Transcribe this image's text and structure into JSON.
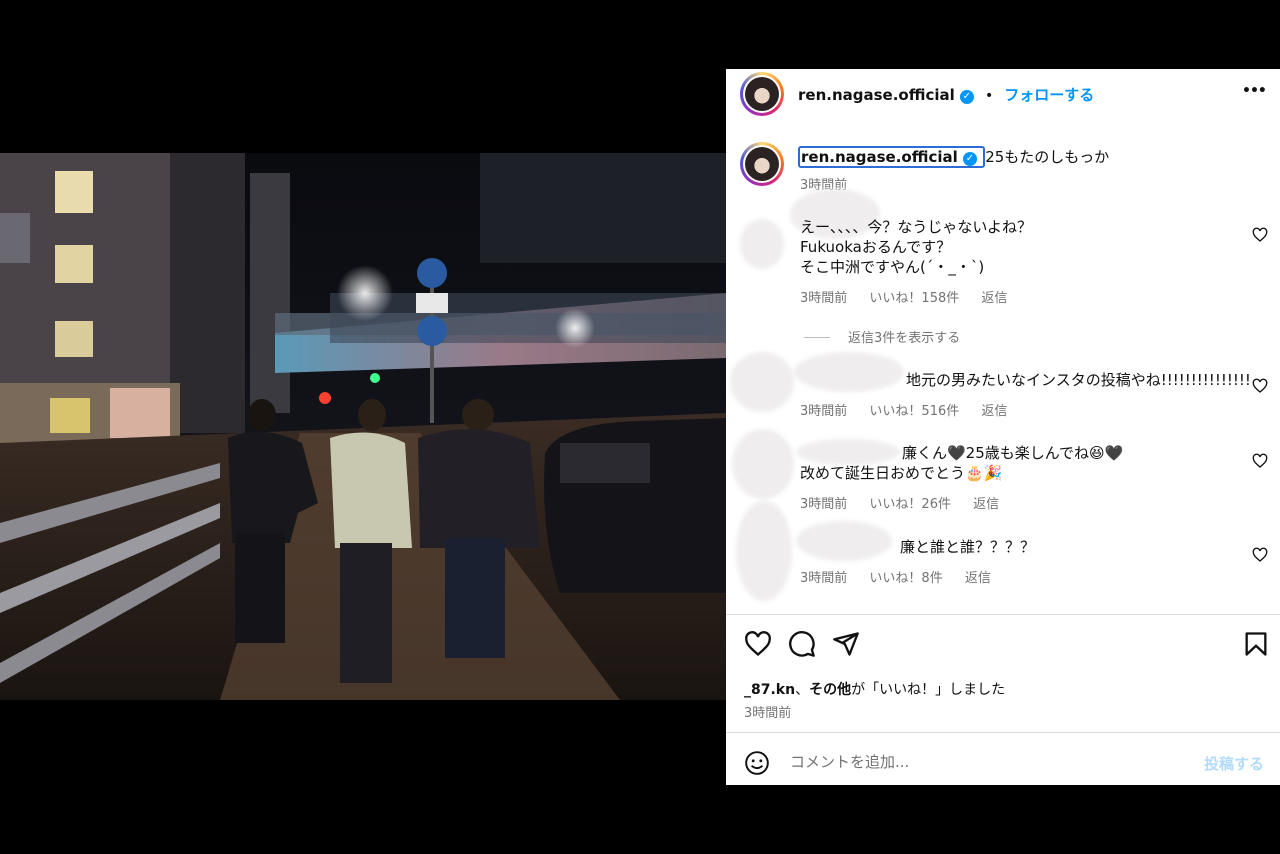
{
  "post": {
    "username": "ren.nagase.official",
    "follow_label": "フォローする",
    "separator": "•",
    "verified_mark": "✓",
    "more_label": "•••"
  },
  "caption": {
    "username": "ren.nagase.official",
    "text": "25もたのしもっか",
    "time": "3時間前"
  },
  "comments": [
    {
      "text_lines": [
        "えー、、、、今？なうじゃないよね？",
        "Fukuokaおるんです？",
        "そこ中洲ですやん(´・_・`)"
      ],
      "time": "3時間前",
      "likes": "いいね！158件",
      "reply": "返信"
    },
    {
      "text_lines": [
        "地元の男みたいなインスタの投稿やね!!!!!!!!!!!!!!!"
      ],
      "time": "3時間前",
      "likes": "いいね！516件",
      "reply": "返信"
    },
    {
      "text_lines": [
        "廉くん🖤25歳も楽しんでね😆🖤",
        "改めて誕生日おめでとう🎂🎉"
      ],
      "time": "3時間前",
      "likes": "いいね！26件",
      "reply": "返信"
    },
    {
      "text_lines": [
        "廉と誰と誰？？？？"
      ],
      "time": "3時間前",
      "likes": "いいね！8件",
      "reply": "返信"
    }
  ],
  "view_replies": "返信3件を表示する",
  "likes_line": {
    "user": "_87.kn",
    "sep": "、",
    "others": "その他",
    "suffix": "が「いいね！」しました"
  },
  "post_time": "3時間前",
  "add_comment": {
    "placeholder": "コメントを追加...",
    "post_label": "投稿する"
  },
  "colors": {
    "accent": "#0095f6",
    "muted": "#737373",
    "post_disabled": "#b3dbff"
  },
  "icons": [
    "heart-icon",
    "comment-icon",
    "share-icon",
    "bookmark-icon",
    "emoji-icon",
    "more-icon",
    "verified-icon"
  ]
}
